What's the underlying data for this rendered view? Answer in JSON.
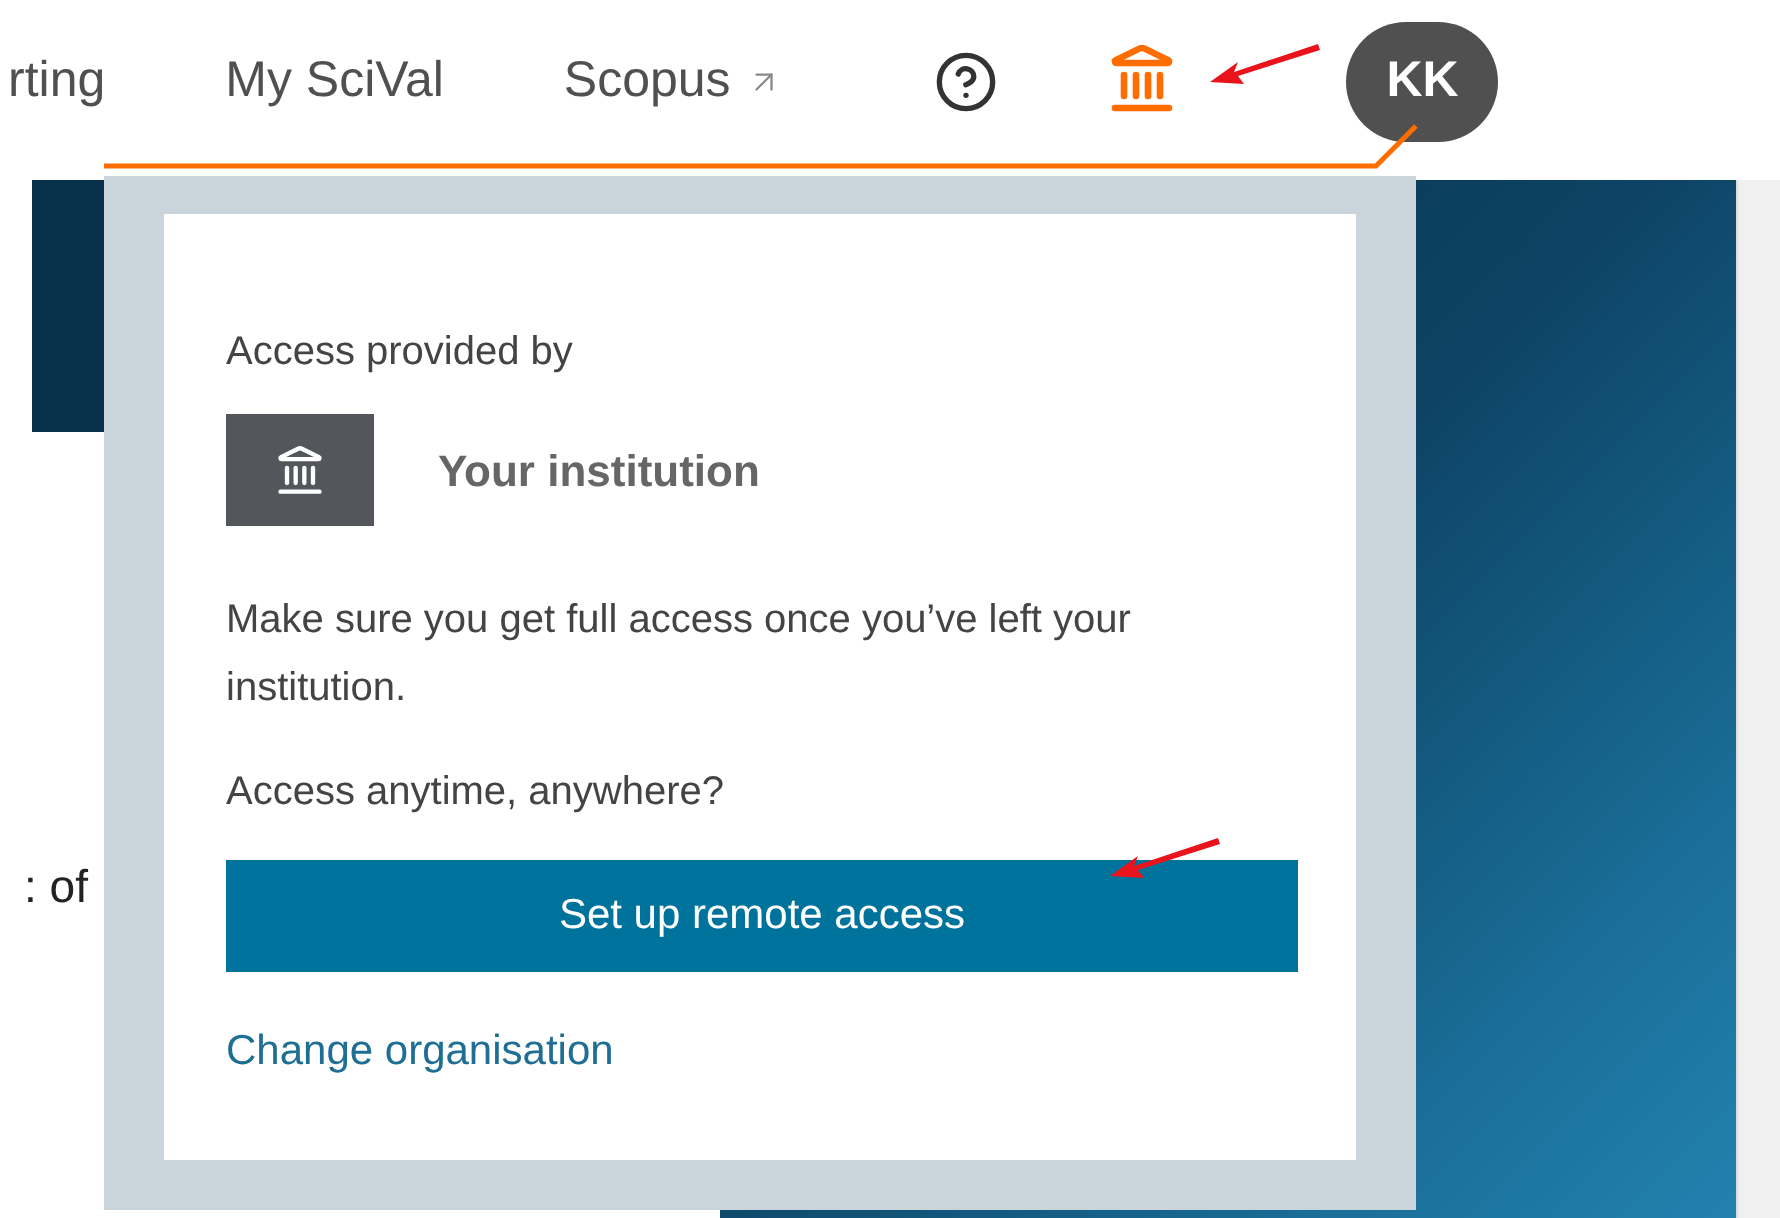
{
  "nav": {
    "items": [
      {
        "label": "rting",
        "external": false
      },
      {
        "label": "My SciVal",
        "external": false
      },
      {
        "label": "Scopus",
        "external": true
      }
    ]
  },
  "avatar": {
    "initials": "KK"
  },
  "background_text": ": of",
  "popover": {
    "heading": "Access provided by",
    "institution": "Your institution",
    "message": "Make sure you get full access once you’ve left your institution.",
    "question": "Access anytime, anywhere?",
    "button": "Set up remote access",
    "link": "Change organisation"
  }
}
